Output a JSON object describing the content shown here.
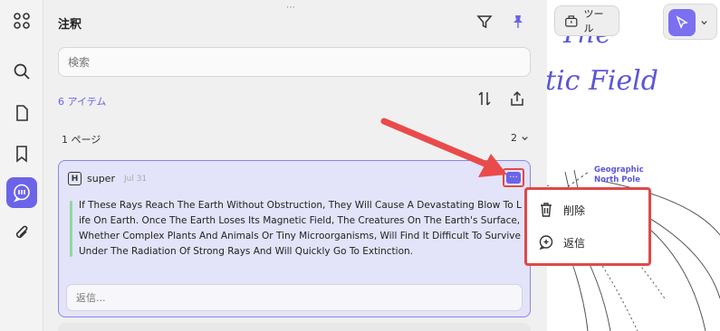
{
  "rail": {
    "items": [
      {
        "name": "apps-icon"
      },
      {
        "name": "search-icon"
      },
      {
        "name": "page-icon"
      },
      {
        "name": "bookmark-icon"
      },
      {
        "name": "comment-icon",
        "active": true
      },
      {
        "name": "attachment-icon"
      }
    ]
  },
  "panel": {
    "title": "注釈",
    "search_placeholder": "検索",
    "item_count": "6 アイテム",
    "page_label": "1 ページ",
    "page_item_count": "2"
  },
  "comment": {
    "user": "super",
    "date": "Jul 31",
    "quote": "If These Rays Reach The Earth Without Obstruction, They Will Cause A Devastating Blow To Life On Earth. Once The Earth Loses Its Magnetic Field, The Creatures On The Earth's Surface, Whether Complex Plants And Animals Or Tiny Microorganisms, Will Find It Difficult To Survive Under The Radiation Of Strong Rays And Will Quickly Go To Extinction.",
    "reply_placeholder": "返信...",
    "more_label": "···"
  },
  "menu": {
    "delete_label": "削除",
    "reply_label": "返信"
  },
  "document": {
    "title_line1": "The",
    "title_line2": "tic Field",
    "geo_label_line1": "Geographic",
    "geo_label_line2": "North Pole",
    "tool_label": "ツール"
  },
  "colors": {
    "accent": "#6b63e8",
    "card_bg": "#e3e3f9",
    "highlight": "#e04848",
    "quote_bar": "#8fd9a0"
  }
}
